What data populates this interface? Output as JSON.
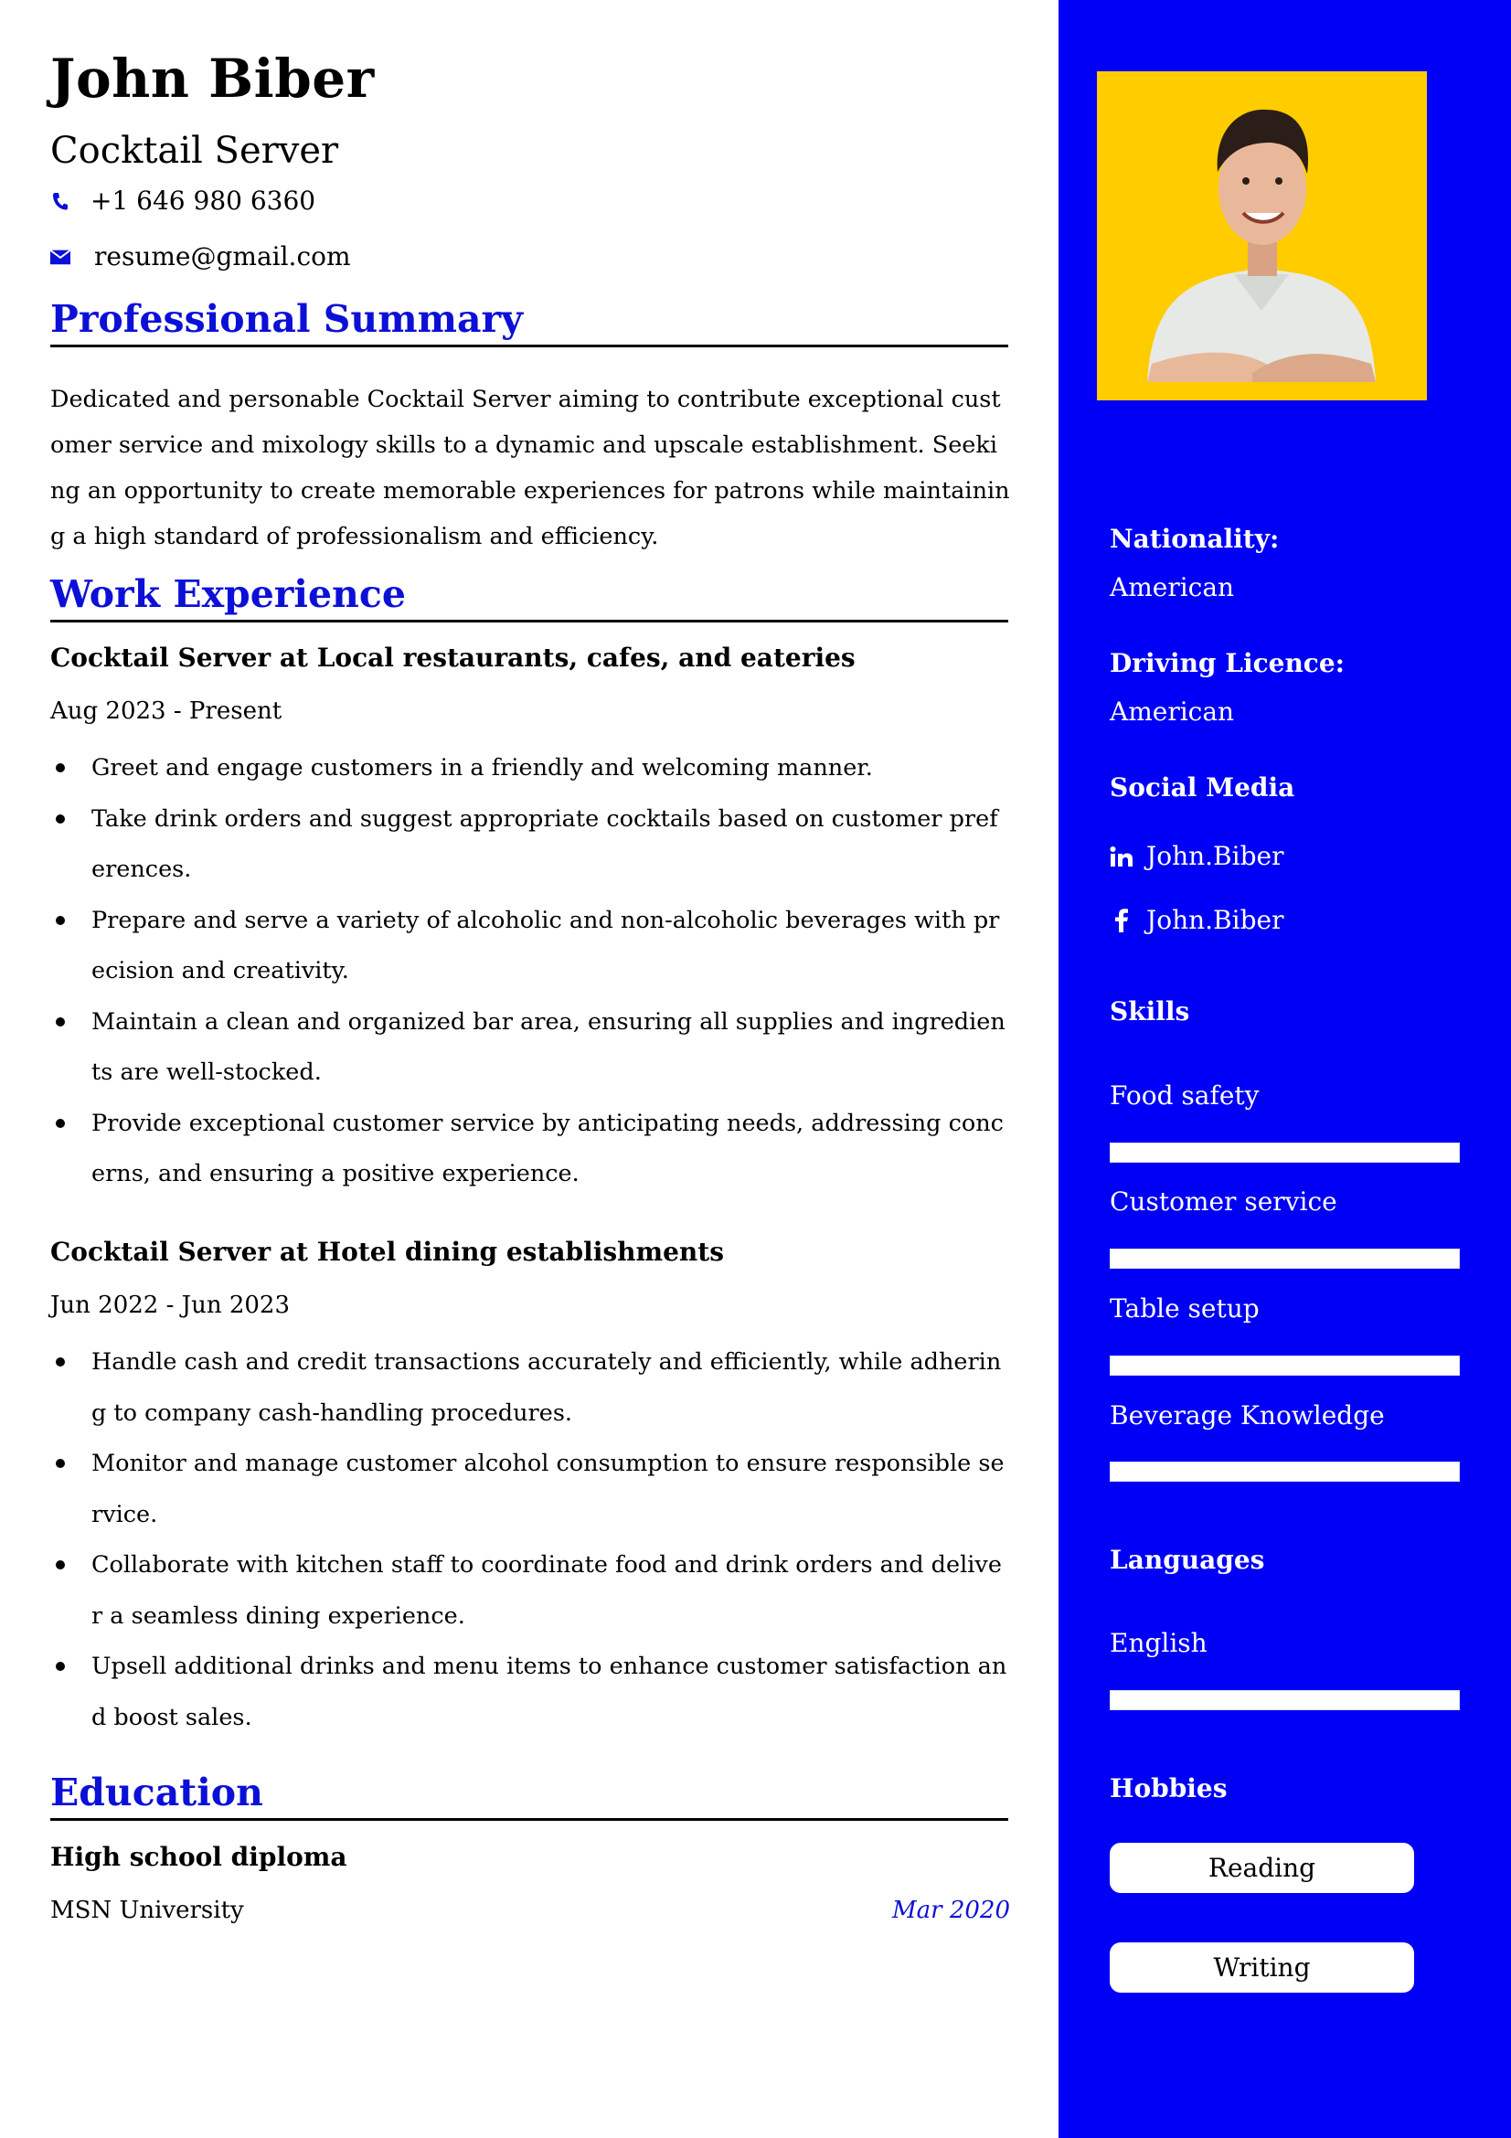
{
  "header": {
    "name": "John Biber",
    "title": "Cocktail Server",
    "phone": "+1 646 980 6360",
    "email": "resume@gmail.com",
    "phone_icon": "phone-icon",
    "email_icon": "envelope-icon"
  },
  "colors": {
    "accent": "#0c10d6",
    "sidebar": "#0000f7",
    "photo_bg": "#ffcc00"
  },
  "sections": {
    "summary_title": "Professional Summary",
    "experience_title": "Work Experience",
    "education_title": "Education"
  },
  "summary": "Dedicated and personable Cocktail Server aiming to contribute exceptional customer service and mixology skills to a dynamic and upscale establishment. Seeking an opportunity to create memorable experiences for patrons while maintaining a high standard of professionalism and efficiency.",
  "experience": [
    {
      "heading": "Cocktail Server at Local restaurants, cafes, and eateries",
      "dates": "Aug 2023 - Present",
      "bullets": [
        "Greet and engage customers in a friendly and welcoming manner.",
        "Take drink orders and suggest appropriate cocktails based on customer preferences.",
        "Prepare and serve a variety of alcoholic and non-alcoholic beverages with precision and creativity.",
        "Maintain a clean and organized bar area, ensuring all supplies and ingredients are well-stocked.",
        "Provide exceptional customer service by anticipating needs, addressing concerns, and ensuring a positive experience."
      ]
    },
    {
      "heading": "Cocktail Server at Hotel dining establishments",
      "dates": "Jun 2022 - Jun 2023",
      "bullets": [
        "Handle cash and credit transactions accurately and efficiently, while adhering to company cash-handling procedures.",
        "Monitor and manage customer alcohol consumption to ensure responsible service.",
        "Collaborate with kitchen staff to coordinate food and drink orders and deliver a seamless dining experience.",
        "Upsell additional drinks and menu items to enhance customer satisfaction and boost sales."
      ]
    }
  ],
  "education": {
    "degree": "High school diploma",
    "school": "MSN University",
    "date": "Mar 2020"
  },
  "sidebar": {
    "nationality_label": "Nationality:",
    "nationality": "American",
    "licence_label": "Driving Licence:",
    "licence": "American",
    "social_title": "Social Media",
    "social": [
      {
        "icon": "linkedin-icon",
        "handle": "John.Biber"
      },
      {
        "icon": "facebook-icon",
        "handle": "John.Biber"
      }
    ],
    "skills_title": "Skills",
    "skills": [
      {
        "name": "Food safety",
        "level": 1.0
      },
      {
        "name": "Customer service",
        "level": 1.0
      },
      {
        "name": "Table setup",
        "level": 1.0
      },
      {
        "name": "Beverage Knowledge",
        "level": 1.0
      }
    ],
    "languages_title": "Languages",
    "languages": [
      {
        "name": "English",
        "level": 1.0
      }
    ],
    "hobbies_title": "Hobbies",
    "hobbies": [
      "Reading",
      "Writing"
    ]
  }
}
